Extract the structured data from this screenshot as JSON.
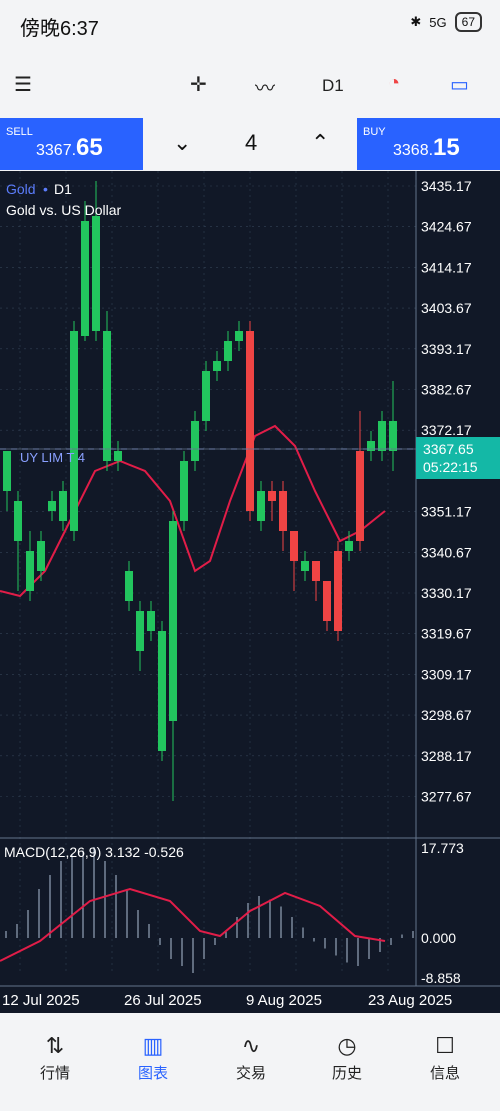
{
  "status": {
    "time": "傍晚6:37",
    "battery": "67",
    "network": "5G"
  },
  "toolbar": {
    "timeframe": "D1"
  },
  "trade": {
    "sell_label": "SELL",
    "sell_small": "3367.",
    "sell_big": "65",
    "buy_label": "BUY",
    "buy_small": "3368.",
    "buy_big": "15",
    "qty": "4"
  },
  "chart": {
    "symbol": "Gold",
    "timeframe": "D1",
    "description": "Gold vs. US Dollar",
    "price_tag": "3367.65",
    "time_tag": "05:22:15",
    "order_label": "UY LIM T 4",
    "macd_label": "MACD(12,26,9) 3.132 -0.526",
    "y_ticks": [
      "3435.17",
      "3424.67",
      "3414.17",
      "3403.67",
      "3393.17",
      "3382.67",
      "3372.17",
      "3351.17",
      "3340.67",
      "3330.17",
      "3319.67",
      "3309.17",
      "3298.67",
      "3288.17",
      "3277.67"
    ],
    "macd_ticks": [
      "17.773",
      "0.000",
      "-8.858"
    ],
    "x_ticks": [
      "12 Jul 2025",
      "26 Jul 2025",
      "9 Aug 2025",
      "23 Aug 2025"
    ],
    "colors": {
      "up": "#22c55e",
      "down": "#ef4444",
      "ma": "#e11d48",
      "bg": "#111827"
    }
  },
  "chart_data": {
    "type": "line",
    "title": "Gold vs. US Dollar",
    "y_labels": [
      "3435.17",
      "3424.67",
      "3414.17",
      "3403.67",
      "3393.17",
      "3382.67",
      "3372.17",
      "3351.17",
      "3340.67",
      "3330.17",
      "3319.67",
      "3309.17",
      "3298.67",
      "3288.17",
      "3277.67"
    ],
    "x_labels": [
      "12 Jul 2025",
      "26 Jul 2025",
      "9 Aug 2025",
      "23 Aug 2025"
    ],
    "last_price": "3367.65"
  },
  "nav": {
    "items": [
      {
        "label": "行情"
      },
      {
        "label": "图表"
      },
      {
        "label": "交易"
      },
      {
        "label": "历史"
      },
      {
        "label": "信息"
      }
    ]
  }
}
